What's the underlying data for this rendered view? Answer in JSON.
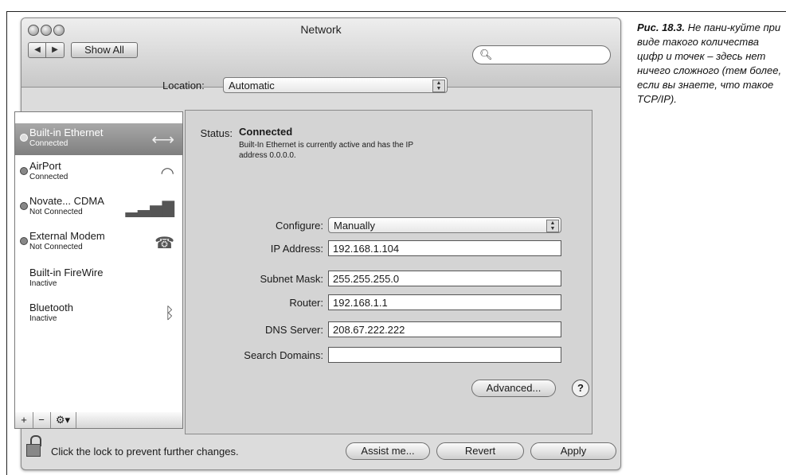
{
  "window": {
    "title": "Network"
  },
  "toolbar": {
    "show_all": "Show All",
    "search_placeholder": ""
  },
  "location": {
    "label": "Location:",
    "value": "Automatic"
  },
  "services": [
    {
      "name": "Built-in Ethernet",
      "status": "Connected",
      "selected": true,
      "icon": "ethernet-icon"
    },
    {
      "name": "AirPort",
      "status": "Connected",
      "selected": false,
      "icon": "wifi-icon"
    },
    {
      "name": "Novate... CDMA",
      "status": "Not Connected",
      "selected": false,
      "icon": "signal-bars-icon"
    },
    {
      "name": "External Modem",
      "status": "Not Connected",
      "selected": false,
      "icon": "phone-icon"
    },
    {
      "name": "Built-in FireWire",
      "status": "Inactive",
      "selected": false,
      "icon": ""
    },
    {
      "name": "Bluetooth",
      "status": "Inactive",
      "selected": false,
      "icon": "bluetooth-icon"
    }
  ],
  "list_controls": {
    "add": "+",
    "remove": "−",
    "action": "⚙▾"
  },
  "detail": {
    "status_label": "Status:",
    "status_value": "Connected",
    "status_description": "Built-In Ethernet is currently active and has the IP address 0.0.0.0.",
    "configure_label": "Configure:",
    "configure_value": "Manually",
    "ip_label": "IP Address:",
    "ip_value": "192.168.1.104",
    "subnet_label": "Subnet Mask:",
    "subnet_value": "255.255.255.0",
    "router_label": "Router:",
    "router_value": "192.168.1.1",
    "dns_label": "DNS Server:",
    "dns_value": "208.67.222.222",
    "search_domains_label": "Search Domains:",
    "search_domains_value": "",
    "advanced": "Advanced...",
    "help": "?"
  },
  "footer": {
    "lock_text": "Click the lock to prevent further changes.",
    "assist": "Assist me...",
    "revert": "Revert",
    "apply": "Apply"
  },
  "caption": {
    "figure": "Рис. 18.3.",
    "text": "Не пани-куйте при виде такого количества цифр и точек – здесь нет ничего сложного (тем более, если вы знаете, что такое TCP/IP)."
  }
}
